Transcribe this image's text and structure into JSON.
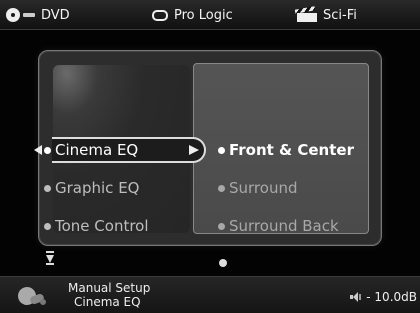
{
  "status_bar": {
    "input": "DVD",
    "mode": "Pro Logic",
    "genre": "Sci-Fi"
  },
  "left_menu": {
    "items": [
      {
        "label": "Cinema EQ",
        "selected": true
      },
      {
        "label": "Graphic EQ",
        "selected": false
      },
      {
        "label": "Tone Control",
        "selected": false
      }
    ]
  },
  "right_menu": {
    "items": [
      {
        "label": "Front & Center",
        "active": true
      },
      {
        "label": "Surround",
        "active": false
      },
      {
        "label": "Surround Back",
        "active": false
      }
    ]
  },
  "footer": {
    "breadcrumb_parent": "Manual Setup",
    "breadcrumb_current": "Cinema EQ",
    "volume": "- 10.0dB"
  },
  "icons": {
    "input": "disc-icon",
    "mode": "dolby-dd-icon",
    "genre": "clapperboard-icon",
    "setup": "setup-icon",
    "volume": "speaker-icon"
  },
  "colors": {
    "background": "#000000",
    "panel": "#2d2d2d",
    "panel_right": "#4d4d4d",
    "text_active": "#ffffff",
    "text_inactive": "#bdbdbd"
  }
}
